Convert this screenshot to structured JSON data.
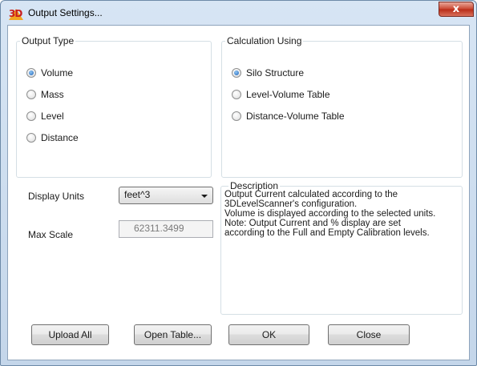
{
  "window": {
    "title": "Output Settings...",
    "close_glyph": "x",
    "app_icon": "3D"
  },
  "output_type": {
    "legend": "Output Type",
    "options": [
      "Volume",
      "Mass",
      "Level",
      "Distance"
    ],
    "selected": "Volume"
  },
  "calculation": {
    "legend": "Calculation Using",
    "options": [
      "Silo Structure",
      "Level-Volume Table",
      "Distance-Volume Table"
    ],
    "selected": "Silo Structure"
  },
  "display_units": {
    "label": "Display Units",
    "value": "feet^3"
  },
  "max_scale": {
    "label": "Max Scale",
    "value": "62311.3499"
  },
  "description": {
    "title": "Description",
    "lines": [
      "Output Current calculated according to the",
      "3DLevelScanner's configuration.",
      "Volume is displayed according to the selected units.",
      "Note: Output Current and % display are set",
      "according to the Full and Empty Calibration levels."
    ]
  },
  "buttons": {
    "upload_all": "Upload All",
    "open_table": "Open Table...",
    "ok": "OK",
    "close": "Close"
  }
}
